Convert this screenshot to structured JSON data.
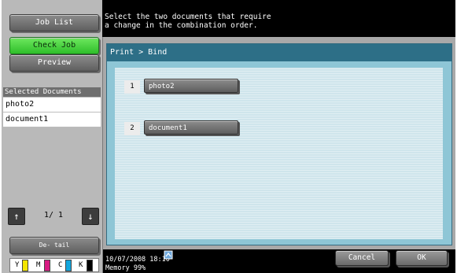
{
  "sidebar": {
    "job_list_label": "Job List",
    "check_job_label": "Check Job",
    "preview_label": "Preview",
    "selected_header": "Selected Documents",
    "documents": [
      "photo2",
      "document1"
    ],
    "pager_text": "1/ 1",
    "detail_label": "De-\ntail"
  },
  "toner": [
    "Y",
    "M",
    "C",
    "K"
  ],
  "toner_colors": {
    "Y": "#f4e600",
    "M": "#d81b82",
    "C": "#12a6dd",
    "K": "#000000"
  },
  "message": "Select the two documents that require\na change in the combination order.",
  "panel": {
    "title": "Print > Bind"
  },
  "order": [
    {
      "num": "1",
      "doc": "photo2"
    },
    {
      "num": "2",
      "doc": "document1"
    }
  ],
  "status": {
    "datetime": "10/07/2008   18:10",
    "memory": "Memory       99%"
  },
  "buttons": {
    "cancel": "Cancel",
    "ok": "OK"
  },
  "icons": {
    "up": "arrow-up-icon",
    "down": "arrow-down-icon",
    "network": "network-icon"
  }
}
